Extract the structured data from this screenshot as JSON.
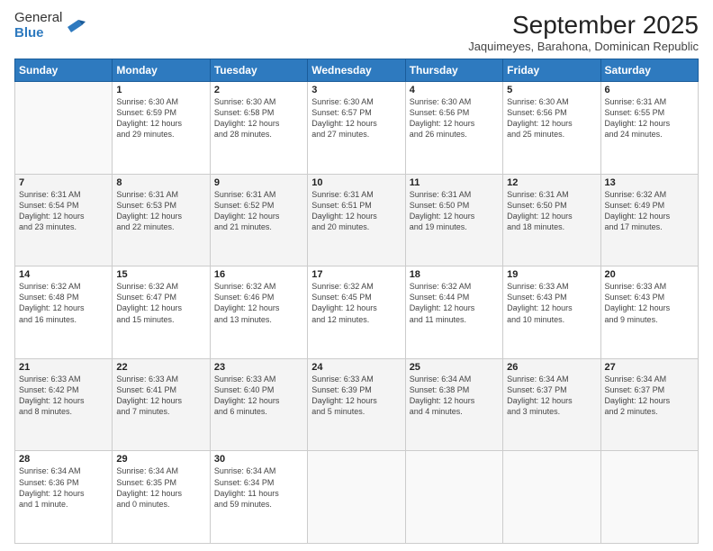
{
  "logo": {
    "general": "General",
    "blue": "Blue"
  },
  "header": {
    "title": "September 2025",
    "subtitle": "Jaquimeyes, Barahona, Dominican Republic"
  },
  "days_of_week": [
    "Sunday",
    "Monday",
    "Tuesday",
    "Wednesday",
    "Thursday",
    "Friday",
    "Saturday"
  ],
  "weeks": [
    [
      {
        "day": "",
        "info": ""
      },
      {
        "day": "1",
        "info": "Sunrise: 6:30 AM\nSunset: 6:59 PM\nDaylight: 12 hours\nand 29 minutes."
      },
      {
        "day": "2",
        "info": "Sunrise: 6:30 AM\nSunset: 6:58 PM\nDaylight: 12 hours\nand 28 minutes."
      },
      {
        "day": "3",
        "info": "Sunrise: 6:30 AM\nSunset: 6:57 PM\nDaylight: 12 hours\nand 27 minutes."
      },
      {
        "day": "4",
        "info": "Sunrise: 6:30 AM\nSunset: 6:56 PM\nDaylight: 12 hours\nand 26 minutes."
      },
      {
        "day": "5",
        "info": "Sunrise: 6:30 AM\nSunset: 6:56 PM\nDaylight: 12 hours\nand 25 minutes."
      },
      {
        "day": "6",
        "info": "Sunrise: 6:31 AM\nSunset: 6:55 PM\nDaylight: 12 hours\nand 24 minutes."
      }
    ],
    [
      {
        "day": "7",
        "info": "Sunrise: 6:31 AM\nSunset: 6:54 PM\nDaylight: 12 hours\nand 23 minutes."
      },
      {
        "day": "8",
        "info": "Sunrise: 6:31 AM\nSunset: 6:53 PM\nDaylight: 12 hours\nand 22 minutes."
      },
      {
        "day": "9",
        "info": "Sunrise: 6:31 AM\nSunset: 6:52 PM\nDaylight: 12 hours\nand 21 minutes."
      },
      {
        "day": "10",
        "info": "Sunrise: 6:31 AM\nSunset: 6:51 PM\nDaylight: 12 hours\nand 20 minutes."
      },
      {
        "day": "11",
        "info": "Sunrise: 6:31 AM\nSunset: 6:50 PM\nDaylight: 12 hours\nand 19 minutes."
      },
      {
        "day": "12",
        "info": "Sunrise: 6:31 AM\nSunset: 6:50 PM\nDaylight: 12 hours\nand 18 minutes."
      },
      {
        "day": "13",
        "info": "Sunrise: 6:32 AM\nSunset: 6:49 PM\nDaylight: 12 hours\nand 17 minutes."
      }
    ],
    [
      {
        "day": "14",
        "info": "Sunrise: 6:32 AM\nSunset: 6:48 PM\nDaylight: 12 hours\nand 16 minutes."
      },
      {
        "day": "15",
        "info": "Sunrise: 6:32 AM\nSunset: 6:47 PM\nDaylight: 12 hours\nand 15 minutes."
      },
      {
        "day": "16",
        "info": "Sunrise: 6:32 AM\nSunset: 6:46 PM\nDaylight: 12 hours\nand 13 minutes."
      },
      {
        "day": "17",
        "info": "Sunrise: 6:32 AM\nSunset: 6:45 PM\nDaylight: 12 hours\nand 12 minutes."
      },
      {
        "day": "18",
        "info": "Sunrise: 6:32 AM\nSunset: 6:44 PM\nDaylight: 12 hours\nand 11 minutes."
      },
      {
        "day": "19",
        "info": "Sunrise: 6:33 AM\nSunset: 6:43 PM\nDaylight: 12 hours\nand 10 minutes."
      },
      {
        "day": "20",
        "info": "Sunrise: 6:33 AM\nSunset: 6:43 PM\nDaylight: 12 hours\nand 9 minutes."
      }
    ],
    [
      {
        "day": "21",
        "info": "Sunrise: 6:33 AM\nSunset: 6:42 PM\nDaylight: 12 hours\nand 8 minutes."
      },
      {
        "day": "22",
        "info": "Sunrise: 6:33 AM\nSunset: 6:41 PM\nDaylight: 12 hours\nand 7 minutes."
      },
      {
        "day": "23",
        "info": "Sunrise: 6:33 AM\nSunset: 6:40 PM\nDaylight: 12 hours\nand 6 minutes."
      },
      {
        "day": "24",
        "info": "Sunrise: 6:33 AM\nSunset: 6:39 PM\nDaylight: 12 hours\nand 5 minutes."
      },
      {
        "day": "25",
        "info": "Sunrise: 6:34 AM\nSunset: 6:38 PM\nDaylight: 12 hours\nand 4 minutes."
      },
      {
        "day": "26",
        "info": "Sunrise: 6:34 AM\nSunset: 6:37 PM\nDaylight: 12 hours\nand 3 minutes."
      },
      {
        "day": "27",
        "info": "Sunrise: 6:34 AM\nSunset: 6:37 PM\nDaylight: 12 hours\nand 2 minutes."
      }
    ],
    [
      {
        "day": "28",
        "info": "Sunrise: 6:34 AM\nSunset: 6:36 PM\nDaylight: 12 hours\nand 1 minute."
      },
      {
        "day": "29",
        "info": "Sunrise: 6:34 AM\nSunset: 6:35 PM\nDaylight: 12 hours\nand 0 minutes."
      },
      {
        "day": "30",
        "info": "Sunrise: 6:34 AM\nSunset: 6:34 PM\nDaylight: 11 hours\nand 59 minutes."
      },
      {
        "day": "",
        "info": ""
      },
      {
        "day": "",
        "info": ""
      },
      {
        "day": "",
        "info": ""
      },
      {
        "day": "",
        "info": ""
      }
    ]
  ]
}
